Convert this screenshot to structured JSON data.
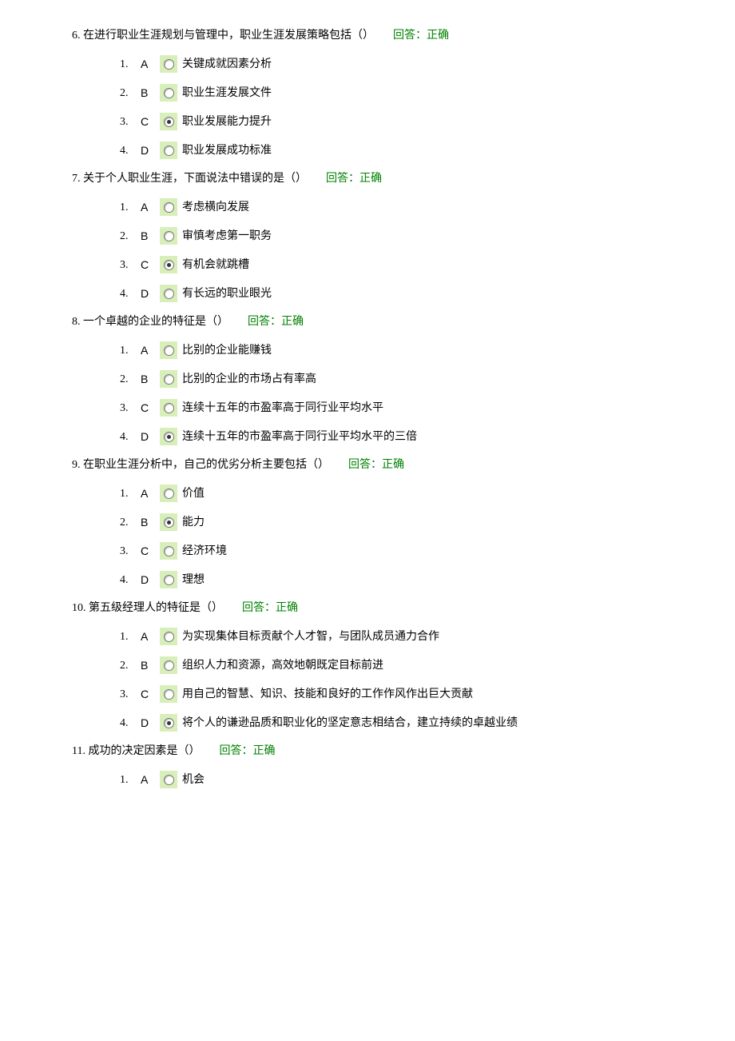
{
  "feedback_prefix": "回答：",
  "questions": [
    {
      "number": "6.",
      "text": "在进行职业生涯规划与管理中，职业生涯发展策略包括（）",
      "feedback": "正确",
      "options": [
        {
          "num": "1.",
          "letter": "A",
          "text": "关键成就因素分析",
          "selected": false
        },
        {
          "num": "2.",
          "letter": "B",
          "text": "职业生涯发展文件",
          "selected": false
        },
        {
          "num": "3.",
          "letter": "C",
          "text": "职业发展能力提升",
          "selected": true
        },
        {
          "num": "4.",
          "letter": "D",
          "text": "职业发展成功标准",
          "selected": false
        }
      ]
    },
    {
      "number": "7.",
      "text": "关于个人职业生涯，下面说法中错误的是（）",
      "feedback": "正确",
      "options": [
        {
          "num": "1.",
          "letter": "A",
          "text": "考虑横向发展",
          "selected": false
        },
        {
          "num": "2.",
          "letter": "B",
          "text": "审慎考虑第一职务",
          "selected": false
        },
        {
          "num": "3.",
          "letter": "C",
          "text": "有机会就跳槽",
          "selected": true
        },
        {
          "num": "4.",
          "letter": "D",
          "text": "有长远的职业眼光",
          "selected": false
        }
      ]
    },
    {
      "number": "8.",
      "text": "一个卓越的企业的特征是（）",
      "feedback": "正确",
      "options": [
        {
          "num": "1.",
          "letter": "A",
          "text": "比别的企业能赚钱",
          "selected": false
        },
        {
          "num": "2.",
          "letter": "B",
          "text": "比别的企业的市场占有率高",
          "selected": false
        },
        {
          "num": "3.",
          "letter": "C",
          "text": "连续十五年的市盈率高于同行业平均水平",
          "selected": false
        },
        {
          "num": "4.",
          "letter": "D",
          "text": "连续十五年的市盈率高于同行业平均水平的三倍",
          "selected": true
        }
      ]
    },
    {
      "number": "9.",
      "text": "在职业生涯分析中，自己的优劣分析主要包括（）",
      "feedback": "正确",
      "options": [
        {
          "num": "1.",
          "letter": "A",
          "text": "价值",
          "selected": false
        },
        {
          "num": "2.",
          "letter": "B",
          "text": "能力",
          "selected": true
        },
        {
          "num": "3.",
          "letter": "C",
          "text": "经济环境",
          "selected": false
        },
        {
          "num": "4.",
          "letter": "D",
          "text": "理想",
          "selected": false
        }
      ]
    },
    {
      "number": "10.",
      "text": "第五级经理人的特征是（）",
      "feedback": "正确",
      "options": [
        {
          "num": "1.",
          "letter": "A",
          "text": "为实现集体目标贡献个人才智，与团队成员通力合作",
          "selected": false
        },
        {
          "num": "2.",
          "letter": "B",
          "text": "组织人力和资源，高效地朝既定目标前进",
          "selected": false
        },
        {
          "num": "3.",
          "letter": "C",
          "text": "用自己的智慧、知识、技能和良好的工作作风作出巨大贡献",
          "selected": false
        },
        {
          "num": "4.",
          "letter": "D",
          "text": "将个人的谦逊品质和职业化的坚定意志相结合，建立持续的卓越业绩",
          "selected": true
        }
      ]
    },
    {
      "number": "11.",
      "text": "成功的决定因素是（）",
      "feedback": "正确",
      "options": [
        {
          "num": "1.",
          "letter": "A",
          "text": "机会",
          "selected": false
        }
      ]
    }
  ]
}
